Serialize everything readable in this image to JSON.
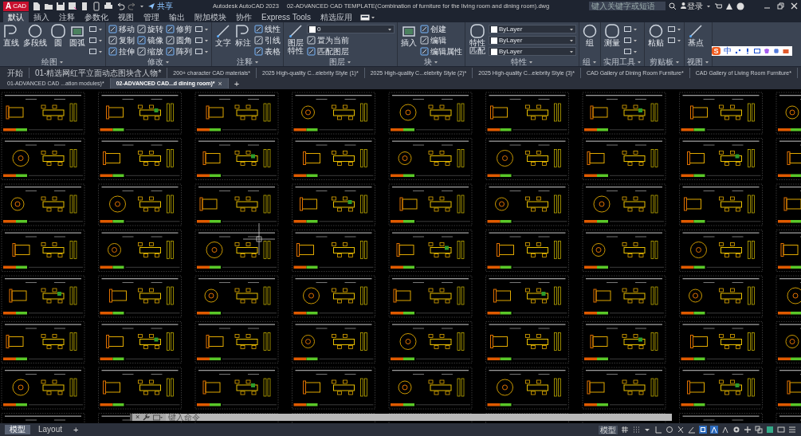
{
  "title_bar": {
    "app_letter": "A",
    "app_badge": "CAD",
    "share": "共享",
    "app_title": "Autodesk AutoCAD 2023",
    "file_name": "02-ADVANCED CAD TEMPLATE(Combination of furniture for the living room and dining room).dwg",
    "search": {
      "placeholder": "键入关键字或短语"
    },
    "sign_in": "登录"
  },
  "ribbon_tabs": [
    {
      "label": "默认",
      "selected": true
    },
    {
      "label": "插入",
      "selected": false
    },
    {
      "label": "注释",
      "selected": false
    },
    {
      "label": "参数化",
      "selected": false
    },
    {
      "label": "视图",
      "selected": false
    },
    {
      "label": "管理",
      "selected": false
    },
    {
      "label": "输出",
      "selected": false
    },
    {
      "label": "附加模块",
      "selected": false
    },
    {
      "label": "协作",
      "selected": false
    },
    {
      "label": "Express Tools",
      "selected": false
    },
    {
      "label": "精选应用",
      "selected": false
    }
  ],
  "ribbon_panels": [
    {
      "title": "绘图",
      "columns": [
        [
          {
            "kind": "large",
            "label": "直线"
          }
        ],
        [
          {
            "kind": "large",
            "label": "多段线"
          }
        ],
        [
          {
            "kind": "large",
            "label": "圆"
          }
        ],
        [
          {
            "kind": "large",
            "label": "圆弧"
          }
        ],
        [
          {
            "kind": "icon"
          },
          {
            "kind": "icon"
          },
          {
            "kind": "icon"
          }
        ]
      ]
    },
    {
      "title": "修改",
      "columns": [
        [
          {
            "kind": "small",
            "label": "移动"
          },
          {
            "kind": "small",
            "label": "复制"
          },
          {
            "kind": "small",
            "label": "拉伸"
          }
        ],
        [
          {
            "kind": "small",
            "label": "旋转"
          },
          {
            "kind": "small",
            "label": "镜像"
          },
          {
            "kind": "small",
            "label": "缩放"
          }
        ],
        [
          {
            "kind": "small",
            "label": "修剪"
          },
          {
            "kind": "small",
            "label": "圆角"
          },
          {
            "kind": "small",
            "label": "阵列"
          }
        ],
        [
          {
            "kind": "icon"
          },
          {
            "kind": "icon"
          },
          {
            "kind": "icon"
          }
        ]
      ]
    },
    {
      "title": "注释",
      "columns": [
        [
          {
            "kind": "large",
            "label": "文字"
          }
        ],
        [
          {
            "kind": "large",
            "label": "标注"
          }
        ],
        [
          {
            "kind": "small",
            "label": "线性"
          },
          {
            "kind": "small",
            "label": "引线"
          },
          {
            "kind": "small",
            "label": "表格"
          }
        ]
      ]
    },
    {
      "title": "图层",
      "columns": [
        [
          {
            "kind": "large",
            "label": "图层特性"
          }
        ],
        [
          {
            "kind": "dropdown",
            "label": "0"
          },
          {
            "kind": "small",
            "label": "置为当前"
          },
          {
            "kind": "small",
            "label": "匹配图层"
          }
        ]
      ]
    },
    {
      "title": "块",
      "columns": [
        [
          {
            "kind": "large",
            "label": "插入"
          }
        ],
        [
          {
            "kind": "small",
            "label": "创建"
          },
          {
            "kind": "small",
            "label": "编辑"
          },
          {
            "kind": "small",
            "label": "编辑属性"
          }
        ]
      ]
    },
    {
      "title": "特性",
      "columns": [
        [
          {
            "kind": "large",
            "label": "特性匹配"
          }
        ],
        [
          {
            "kind": "dropdown",
            "label": "ByLayer"
          },
          {
            "kind": "dropdown",
            "label": "ByLayer"
          },
          {
            "kind": "dropdown",
            "label": "ByLayer"
          }
        ]
      ]
    },
    {
      "title": "组",
      "columns": [
        [
          {
            "kind": "large",
            "label": "组"
          }
        ]
      ]
    },
    {
      "title": "实用工具",
      "columns": [
        [
          {
            "kind": "large",
            "label": "测量"
          }
        ],
        [
          {
            "kind": "icon"
          },
          {
            "kind": "icon"
          },
          {
            "kind": "icon"
          }
        ]
      ]
    },
    {
      "title": "剪贴板",
      "columns": [
        [
          {
            "kind": "large",
            "label": "粘贴"
          }
        ],
        [
          {
            "kind": "icon"
          },
          {
            "kind": "icon"
          }
        ]
      ]
    },
    {
      "title": "视图",
      "columns": [
        [
          {
            "kind": "large",
            "label": "基点"
          }
        ]
      ]
    }
  ],
  "ime_bar": {
    "logo": "S",
    "mode": "中"
  },
  "document_tabs": {
    "tabs": [
      {
        "label": "开始",
        "selected": false
      },
      {
        "label": "01-精选网红平立面动态图块含人物*",
        "selected": false
      },
      {
        "label": "200+ character CAD materials*",
        "selected": false
      },
      {
        "label": "2025 High-quality C...elebrity Style (1)*",
        "selected": false
      },
      {
        "label": "2025 High-quality C...elebrity Style (2)*",
        "selected": false
      },
      {
        "label": "2025 High-quality C...elebrity Style (3)*",
        "selected": false
      },
      {
        "label": "CAD Gallery of Dining Room Furniture*",
        "selected": false
      },
      {
        "label": "CAD Gallery of Living Room Furniture*",
        "selected": false
      },
      {
        "label": "01-ADVANCED CAD ...ation modules)*",
        "selected": false
      },
      {
        "label": "02-ADVANCED CAD...d dining room)*",
        "selected": true
      }
    ],
    "close": "×",
    "new_tab": "+"
  },
  "command_line": {
    "close": "×",
    "placeholder": "键入命令"
  },
  "status_bar": {
    "layout_tabs": [
      {
        "label": "模型",
        "selected": true
      },
      {
        "label": "Layout",
        "selected": false
      }
    ],
    "new_layout": "+",
    "model_button": "模型"
  }
}
